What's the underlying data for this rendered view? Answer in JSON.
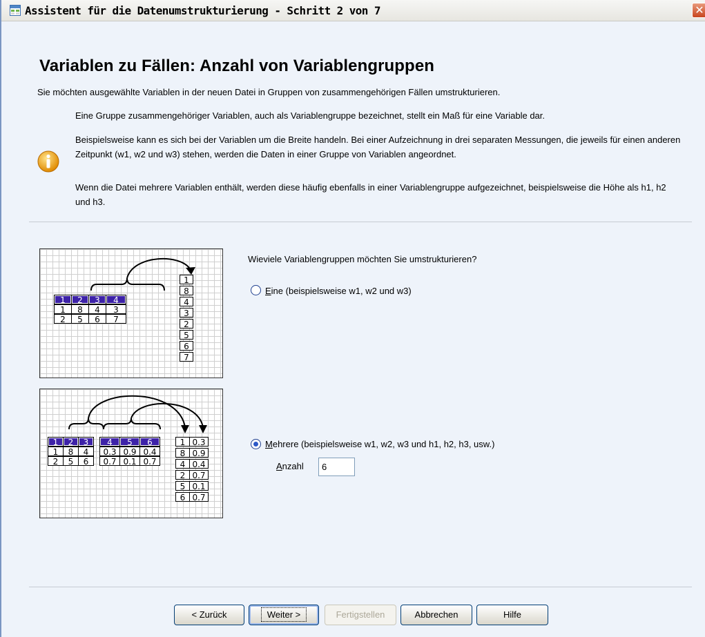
{
  "window": {
    "title": "Assistent für die Datenumstrukturierung - Schritt 2 von 7",
    "close_glyph": "✕"
  },
  "page": {
    "heading": "Variablen zu Fällen: Anzahl von Variablengruppen",
    "intro": "Sie möchten ausgewählte Variablen in der neuen Datei in Gruppen von zusammengehörigen Fällen umstrukturieren.",
    "info_paragraphs": [
      "Eine Gruppe zusammengehöriger Variablen, auch als Variablengruppe bezeichnet, stellt ein Maß für eine Variable dar.",
      "Beispielsweise kann es sich bei der Variablen um die Breite handeln. Bei einer Aufzeichnung in drei separaten Messungen, die jeweils für einen anderen Zeitpunkt (w1, w2 und w3) stehen, werden die Daten in einer Gruppe von Variablen angeordnet.",
      "Wenn die Datei mehrere Variablen enthält, werden diese häufig ebenfalls in einer Variablengruppe aufgezeichnet, beispielsweise die Höhe als h1, h2 und h3."
    ]
  },
  "diagram1": {
    "header": [
      "1",
      "2",
      "3",
      "4"
    ],
    "rows": [
      [
        "1",
        "8",
        "4",
        "3"
      ],
      [
        "2",
        "5",
        "6",
        "7"
      ]
    ],
    "column": [
      "1",
      "8",
      "4",
      "3",
      "2",
      "5",
      "6",
      "7"
    ]
  },
  "diagram2": {
    "header": [
      "1",
      "2",
      "3",
      "4",
      "5",
      "6"
    ],
    "rows": [
      [
        "1",
        "8",
        "4",
        "0.3",
        "0.9",
        "0.4"
      ],
      [
        "2",
        "5",
        "6",
        "0.7",
        "0.1",
        "0.7"
      ]
    ],
    "col_a": [
      "1",
      "8",
      "4",
      "2",
      "5",
      "6"
    ],
    "col_b": [
      "0.3",
      "0.9",
      "0.4",
      "0.7",
      "0.1",
      "0.7"
    ]
  },
  "form": {
    "question": "Wieviele Variablengruppen möchten Sie umstrukturieren?",
    "option_one": {
      "mnemonic": "E",
      "rest": "ine (beispielsweise w1, w2 und w3)",
      "selected": false
    },
    "option_many": {
      "mnemonic": "M",
      "rest": "ehrere (beispielsweise w1, w2, w3 und h1, h2, h3, usw.)",
      "selected": true
    },
    "count_label_mnemonic": "A",
    "count_label_rest": "nzahl",
    "count_value": "6"
  },
  "buttons": {
    "back": "< Zurück",
    "next": "Weiter >",
    "finish": "Fertigstellen",
    "cancel": "Abbrechen",
    "help": "Hilfe"
  }
}
